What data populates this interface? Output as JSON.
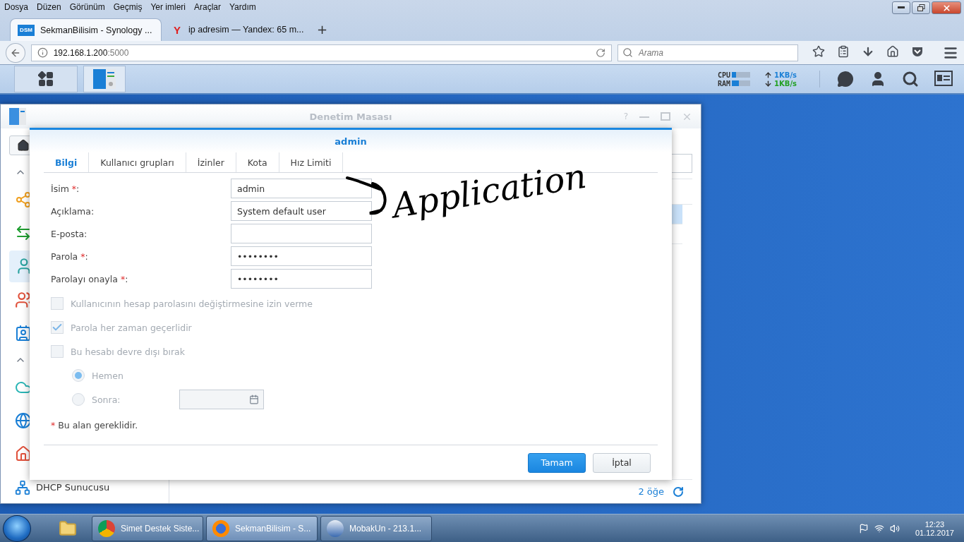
{
  "browser": {
    "menu": [
      "Dosya",
      "Düzen",
      "Görünüm",
      "Geçmiş",
      "Yer imleri",
      "Araçlar",
      "Yardım"
    ],
    "tabs": [
      {
        "label": "SekmanBilisim - Synology ...",
        "selected": true,
        "kind": "dsm",
        "favicon_text": "DSM"
      },
      {
        "label": "ip adresim — Yandex: 65 m...",
        "selected": false,
        "kind": "yandex",
        "favicon_text": "Y"
      }
    ],
    "new_tab": "+",
    "url_host": "192.168.1.200",
    "url_port": ":5000",
    "search": {
      "placeholder": "Arama"
    }
  },
  "dsm_bar": {
    "apps": [
      {
        "kind": "grid",
        "selected": false
      },
      {
        "kind": "panel",
        "selected": true
      }
    ],
    "meters": [
      {
        "label": "CPU",
        "level": 0.22
      },
      {
        "label": "RAM",
        "level": 0.4
      }
    ],
    "rates": [
      {
        "kind": "up",
        "value": "1KB/s",
        "color": "#1a7fd6"
      },
      {
        "kind": "down",
        "value": "1KB/s",
        "color": "#22a022"
      }
    ]
  },
  "window": {
    "title": "Denetim Masası",
    "help": "?",
    "sidebar": [
      {
        "kind": "home",
        "selected": false
      },
      {
        "kind": "caret",
        "selected": false
      },
      {
        "kind": "share",
        "selected": false
      },
      {
        "kind": "sync",
        "selected": false
      },
      {
        "kind": "user",
        "selected": true
      },
      {
        "kind": "group",
        "selected": false
      },
      {
        "kind": "domain",
        "selected": false
      },
      {
        "kind": "caret",
        "selected": false
      },
      {
        "kind": "cloud",
        "selected": false
      },
      {
        "kind": "globe",
        "selected": false
      },
      {
        "kind": "network",
        "selected": false
      },
      {
        "kind": "dhcp",
        "selected": false,
        "label": "DHCP Sunucusu"
      }
    ],
    "rows": [
      {
        "selected": true
      },
      {
        "selected": false
      }
    ],
    "footer": {
      "count": "2 öğe"
    }
  },
  "dialog": {
    "title": "admin",
    "tabs": [
      {
        "label": "Bilgi",
        "selected": true
      },
      {
        "label": "Kullanıcı grupları",
        "selected": false
      },
      {
        "label": "İzinler",
        "selected": false
      },
      {
        "label": "Kota",
        "selected": false
      },
      {
        "label": "Hız Limiti",
        "selected": false
      }
    ],
    "fields": [
      {
        "label": "İsim",
        "required": "*",
        "colon": ":",
        "value": "admin"
      },
      {
        "label": "Açıklama:",
        "value": "System default user"
      },
      {
        "label": "E-posta:"
      },
      {
        "label": "Parola",
        "required": "*",
        "colon": ":",
        "value": "••••••••"
      },
      {
        "label": "Parolayı onayla",
        "required": "*",
        "colon": ":",
        "value": "••••••••"
      }
    ],
    "checkboxes": [
      {
        "label": "Kullanıcının hesap parolasını değiştirmesine izin verme",
        "checked": false,
        "disabled": true
      },
      {
        "label": "Parola her zaman geçerlidir",
        "checked": true,
        "disabled": true
      },
      {
        "label": "Bu hesabı devre dışı bırak",
        "checked": false,
        "disabled": true
      }
    ],
    "radios": [
      {
        "label": "Hemen",
        "selected": true,
        "disabled": true,
        "date_field": false
      },
      {
        "label": "Sonra:",
        "selected": false,
        "disabled": true,
        "date_field": true
      }
    ],
    "note": {
      "mark": "*",
      "text": "Bu alan gereklidir."
    },
    "buttons": [
      {
        "label": "Tamam",
        "kind": "primary"
      },
      {
        "label": "İptal",
        "kind": "secondary"
      }
    ]
  },
  "annotation": {
    "text": "Application"
  },
  "taskbar": {
    "items": [
      {
        "label": "Simet Destek Siste...",
        "kind": "chrome",
        "selected": false
      },
      {
        "label": "SekmanBilisim - S...",
        "kind": "firefox",
        "selected": true
      },
      {
        "label": "MobakUn - 213.1...",
        "kind": "remote",
        "selected": false
      }
    ],
    "time": "12:23",
    "date": "01.12.2017"
  }
}
